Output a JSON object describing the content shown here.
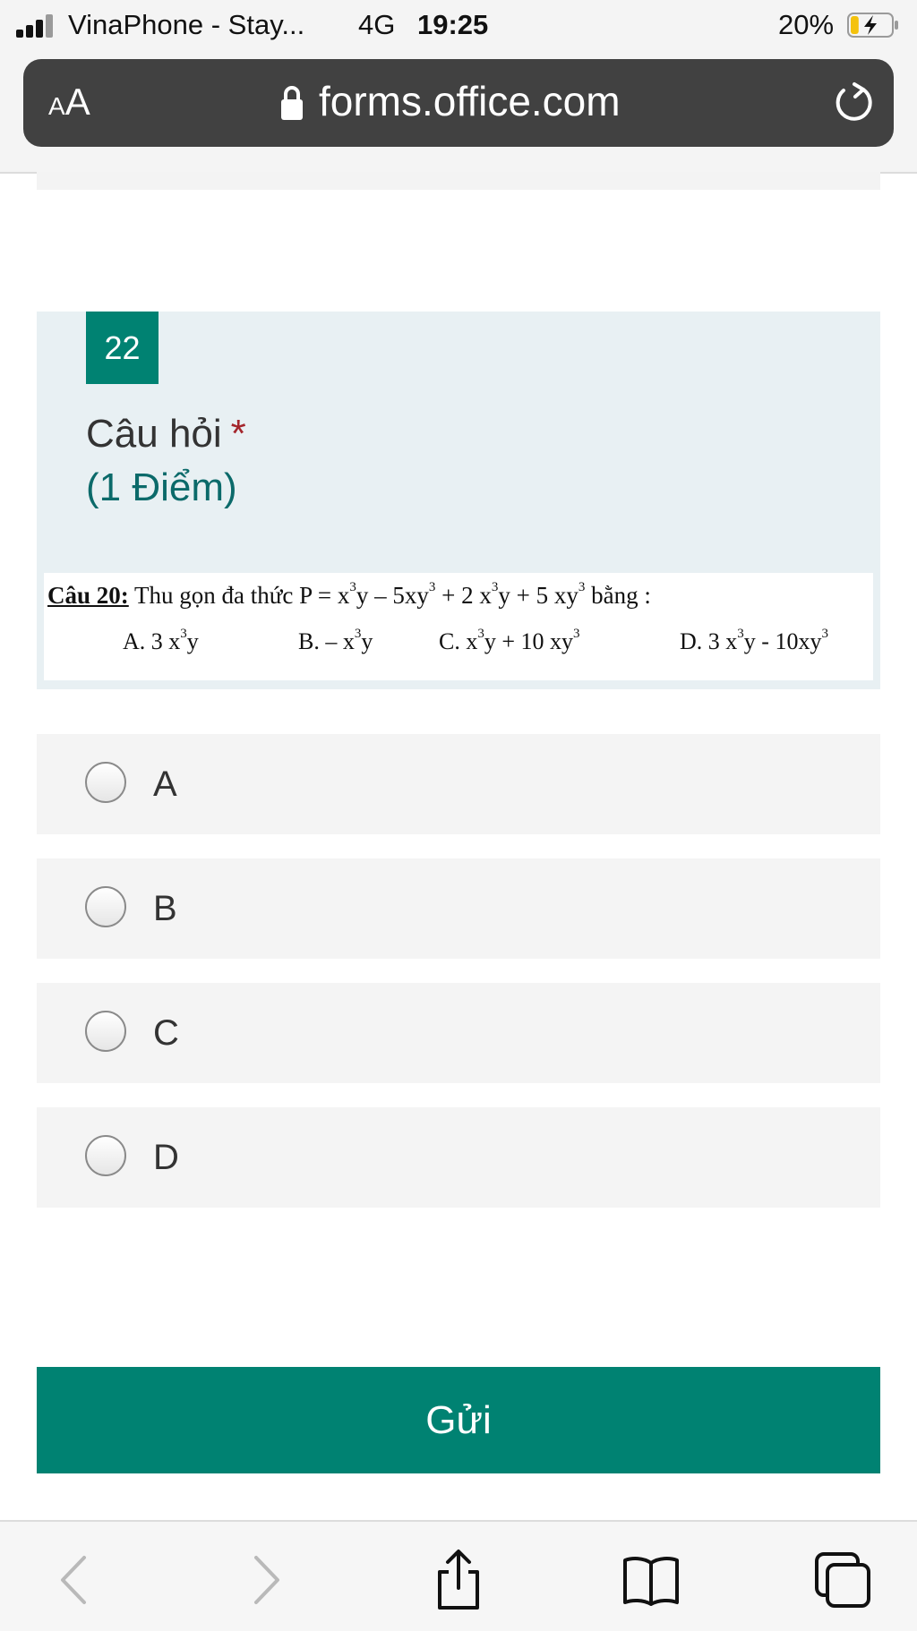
{
  "status_bar": {
    "carrier": "VinaPhone - Stay...",
    "network": "4G",
    "time": "19:25",
    "battery": "20%",
    "battery_level": 0.2
  },
  "browser": {
    "text_size_small": "A",
    "text_size_big": "A",
    "url": "forms.office.com"
  },
  "question": {
    "number": "22",
    "title": "Câu hỏi",
    "required_mark": "*",
    "points": "(1 Điểm)",
    "image_text": {
      "label": "Câu 20:",
      "prompt_parts": [
        "Thu gọn đa thức P = x",
        "3",
        "y – 5xy",
        "3",
        " + 2 x",
        "3",
        "y + 5 xy",
        "3",
        " bằng :"
      ],
      "options": [
        [
          "A. 3 x",
          "3",
          "y"
        ],
        [
          "B. – x",
          "3",
          "y"
        ],
        [
          "C. x",
          "3",
          "y + 10 xy",
          "3"
        ],
        [
          "D. 3 x",
          "3",
          "y - 10xy",
          "3"
        ]
      ]
    }
  },
  "choices": [
    "A",
    "B",
    "C",
    "D"
  ],
  "submit_label": "Gửi",
  "colors": {
    "accent": "#008272",
    "card_background": "#e8f0f3",
    "choice_background": "#f4f4f4",
    "required": "#a4262c"
  },
  "icons": {
    "signal": "signal-bars-icon",
    "battery": "battery-charging-icon",
    "lock": "lock-icon",
    "reload": "reload-icon",
    "back": "chevron-left-icon",
    "forward": "chevron-right-icon",
    "share": "share-icon",
    "bookmarks": "book-icon",
    "tabs": "tabs-icon"
  }
}
